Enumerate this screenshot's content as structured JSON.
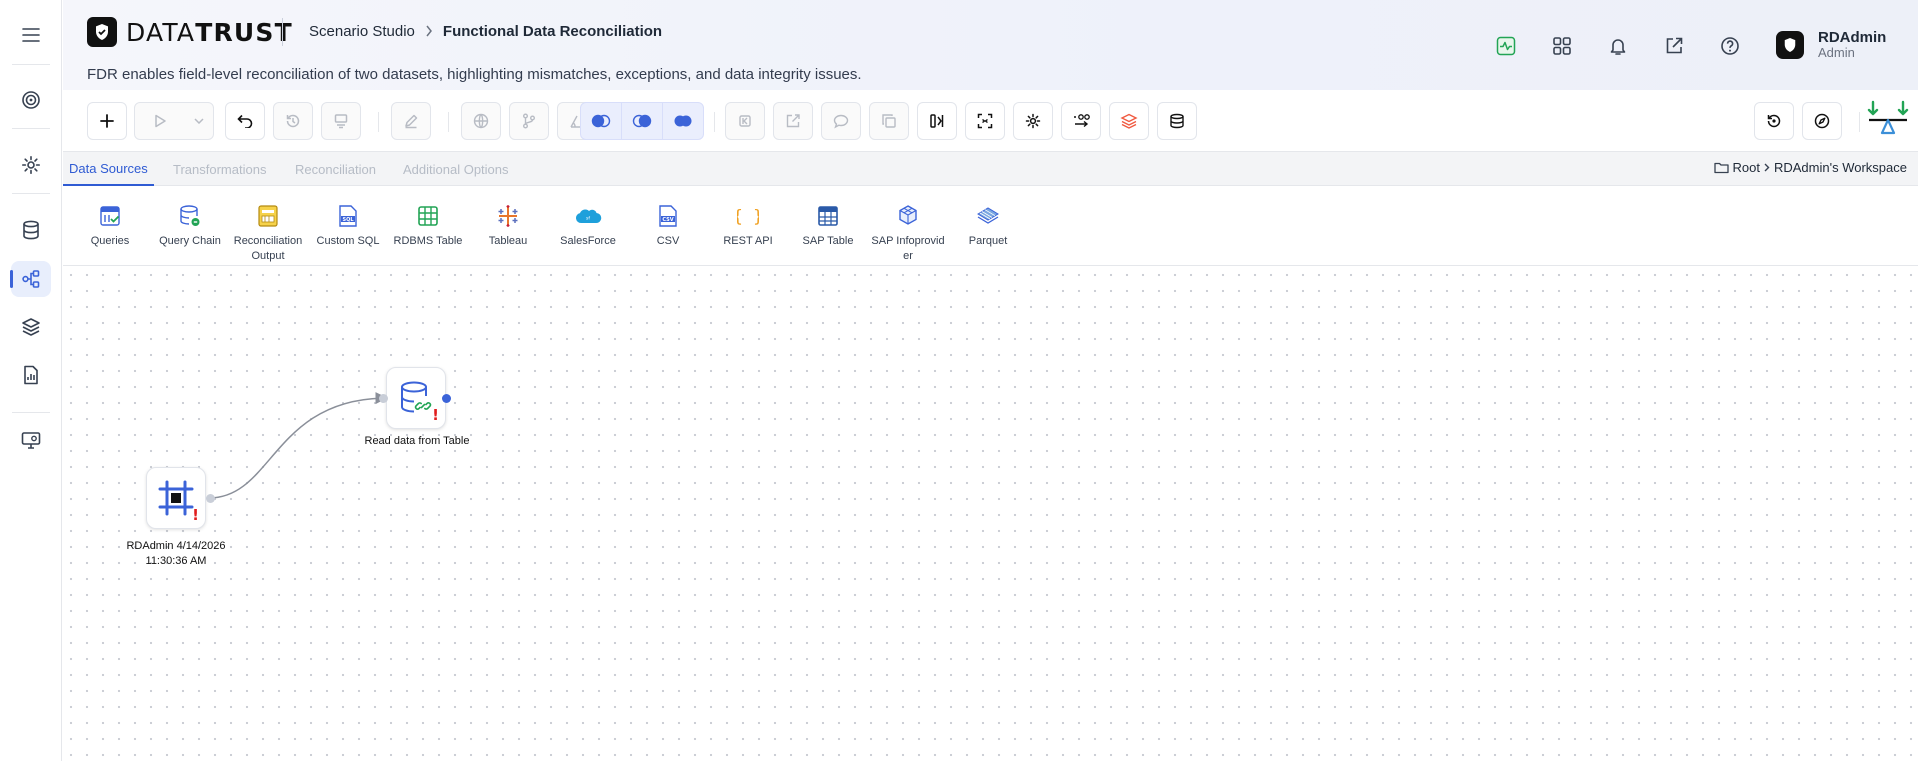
{
  "header": {
    "brand_left": "DATA",
    "brand_right": "TRUST",
    "breadcrumb_parent": "Scenario Studio",
    "breadcrumb_current": "Functional Data Reconciliation",
    "subtitle": "FDR enables field-level reconciliation of two datasets, highlighting mismatches, exceptions, and data integrity issues."
  },
  "user": {
    "name": "RDAdmin",
    "role": "Admin"
  },
  "tabs": [
    {
      "label": "Data Sources",
      "active": true
    },
    {
      "label": "Transformations",
      "active": false
    },
    {
      "label": "Reconciliation",
      "active": false
    },
    {
      "label": "Additional Options",
      "active": false
    }
  ],
  "workspace": {
    "root": "Root",
    "name": "RDAdmin's Workspace"
  },
  "data_sources": [
    {
      "label": "Queries",
      "icon": "queries-icon"
    },
    {
      "label": "Query Chain",
      "icon": "query-chain-icon"
    },
    {
      "label": "Reconciliation Output",
      "icon": "reconciliation-output-icon"
    },
    {
      "label": "Custom SQL",
      "icon": "custom-sql-icon"
    },
    {
      "label": "RDBMS Table",
      "icon": "rdbms-table-icon"
    },
    {
      "label": "Tableau",
      "icon": "tableau-icon"
    },
    {
      "label": "SalesForce",
      "icon": "salesforce-icon"
    },
    {
      "label": "CSV",
      "icon": "csv-icon"
    },
    {
      "label": "REST API",
      "icon": "rest-api-icon"
    },
    {
      "label": "SAP Table",
      "icon": "sap-table-icon"
    },
    {
      "label": "SAP Infoprovider",
      "icon": "sap-infoprovider-icon"
    },
    {
      "label": "Parquet",
      "icon": "parquet-icon"
    }
  ],
  "nodes": {
    "source": {
      "label": "RDAdmin 4/14/2026 11:30:36 AM",
      "icon": "frame-icon",
      "warning": "!"
    },
    "read_table": {
      "label": "Read data from Table",
      "icon": "database-link-icon",
      "warning": "!"
    }
  },
  "colors": {
    "accent": "#2f5bd3",
    "warning": "#e11d1d",
    "success": "#22a455"
  }
}
